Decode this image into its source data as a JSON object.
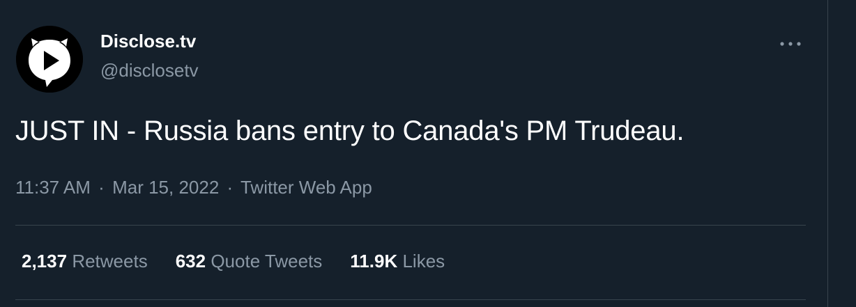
{
  "colors": {
    "background": "#15202b",
    "primary_text": "#ffffff",
    "secondary_text": "#8b98a5",
    "divider": "#38444d"
  },
  "author": {
    "display_name": "Disclose.tv",
    "handle": "@disclosetv",
    "avatar_icon": "disclosetv-logo-icon"
  },
  "more_icon": "more-options-icon",
  "tweet": {
    "text": "JUST IN - Russia bans entry to Canada's PM Trudeau."
  },
  "meta": {
    "time": "11:37 AM",
    "separator": "·",
    "date": "Mar 15, 2022",
    "source": "Twitter Web App"
  },
  "stats": {
    "retweets": {
      "count": "2,137",
      "label": "Retweets"
    },
    "quotes": {
      "count": "632",
      "label": "Quote Tweets"
    },
    "likes": {
      "count": "11.9K",
      "label": "Likes"
    }
  }
}
